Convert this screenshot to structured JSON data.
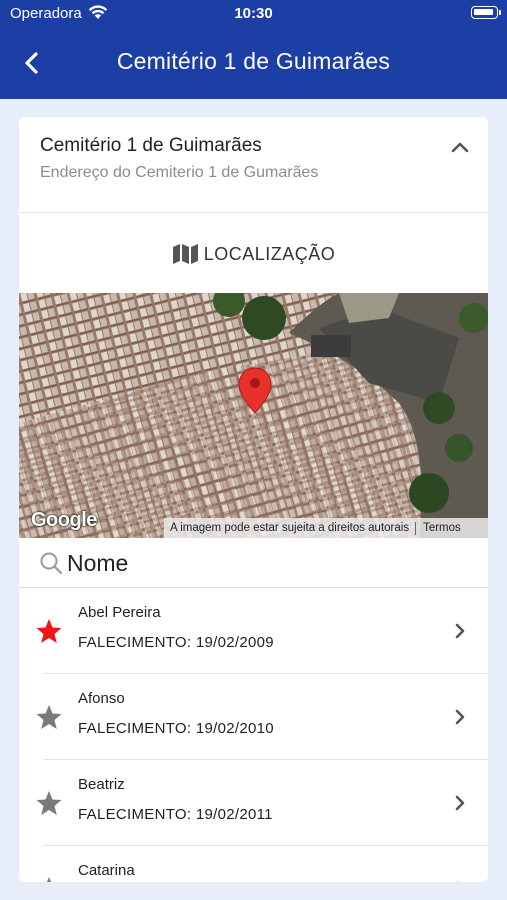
{
  "status_bar": {
    "carrier": "Operadora",
    "time": "10:30"
  },
  "nav": {
    "title": "Cemitério 1 de Guimarães",
    "back_icon": "chevron-left-icon"
  },
  "cemetery": {
    "name": "Cemitério 1 de Guimarães",
    "address": "Endereço do Cemiterio 1 de Gumarães"
  },
  "location": {
    "label": "LOCALIZAÇÃO",
    "icon": "map-icon"
  },
  "map": {
    "logo": "Google",
    "attribution": "A imagem pode estar sujeita a direitos autorais",
    "terms": "Termos",
    "pin_color": "#e8312a"
  },
  "search": {
    "placeholder": "Nome",
    "value": ""
  },
  "people": [
    {
      "name": "Abel Pereira",
      "death": "FALECIMENTO: 19/02/2009",
      "favorite": true
    },
    {
      "name": "Afonso",
      "death": "FALECIMENTO: 19/02/2010",
      "favorite": false
    },
    {
      "name": "Beatriz",
      "death": "FALECIMENTO: 19/02/2011",
      "favorite": false
    },
    {
      "name": "Catarina",
      "death": "",
      "favorite": false
    }
  ],
  "colors": {
    "header": "#1c3fa5",
    "background": "#e8eef9",
    "favorite_star": "#f01414",
    "star": "#7a7a7a"
  }
}
